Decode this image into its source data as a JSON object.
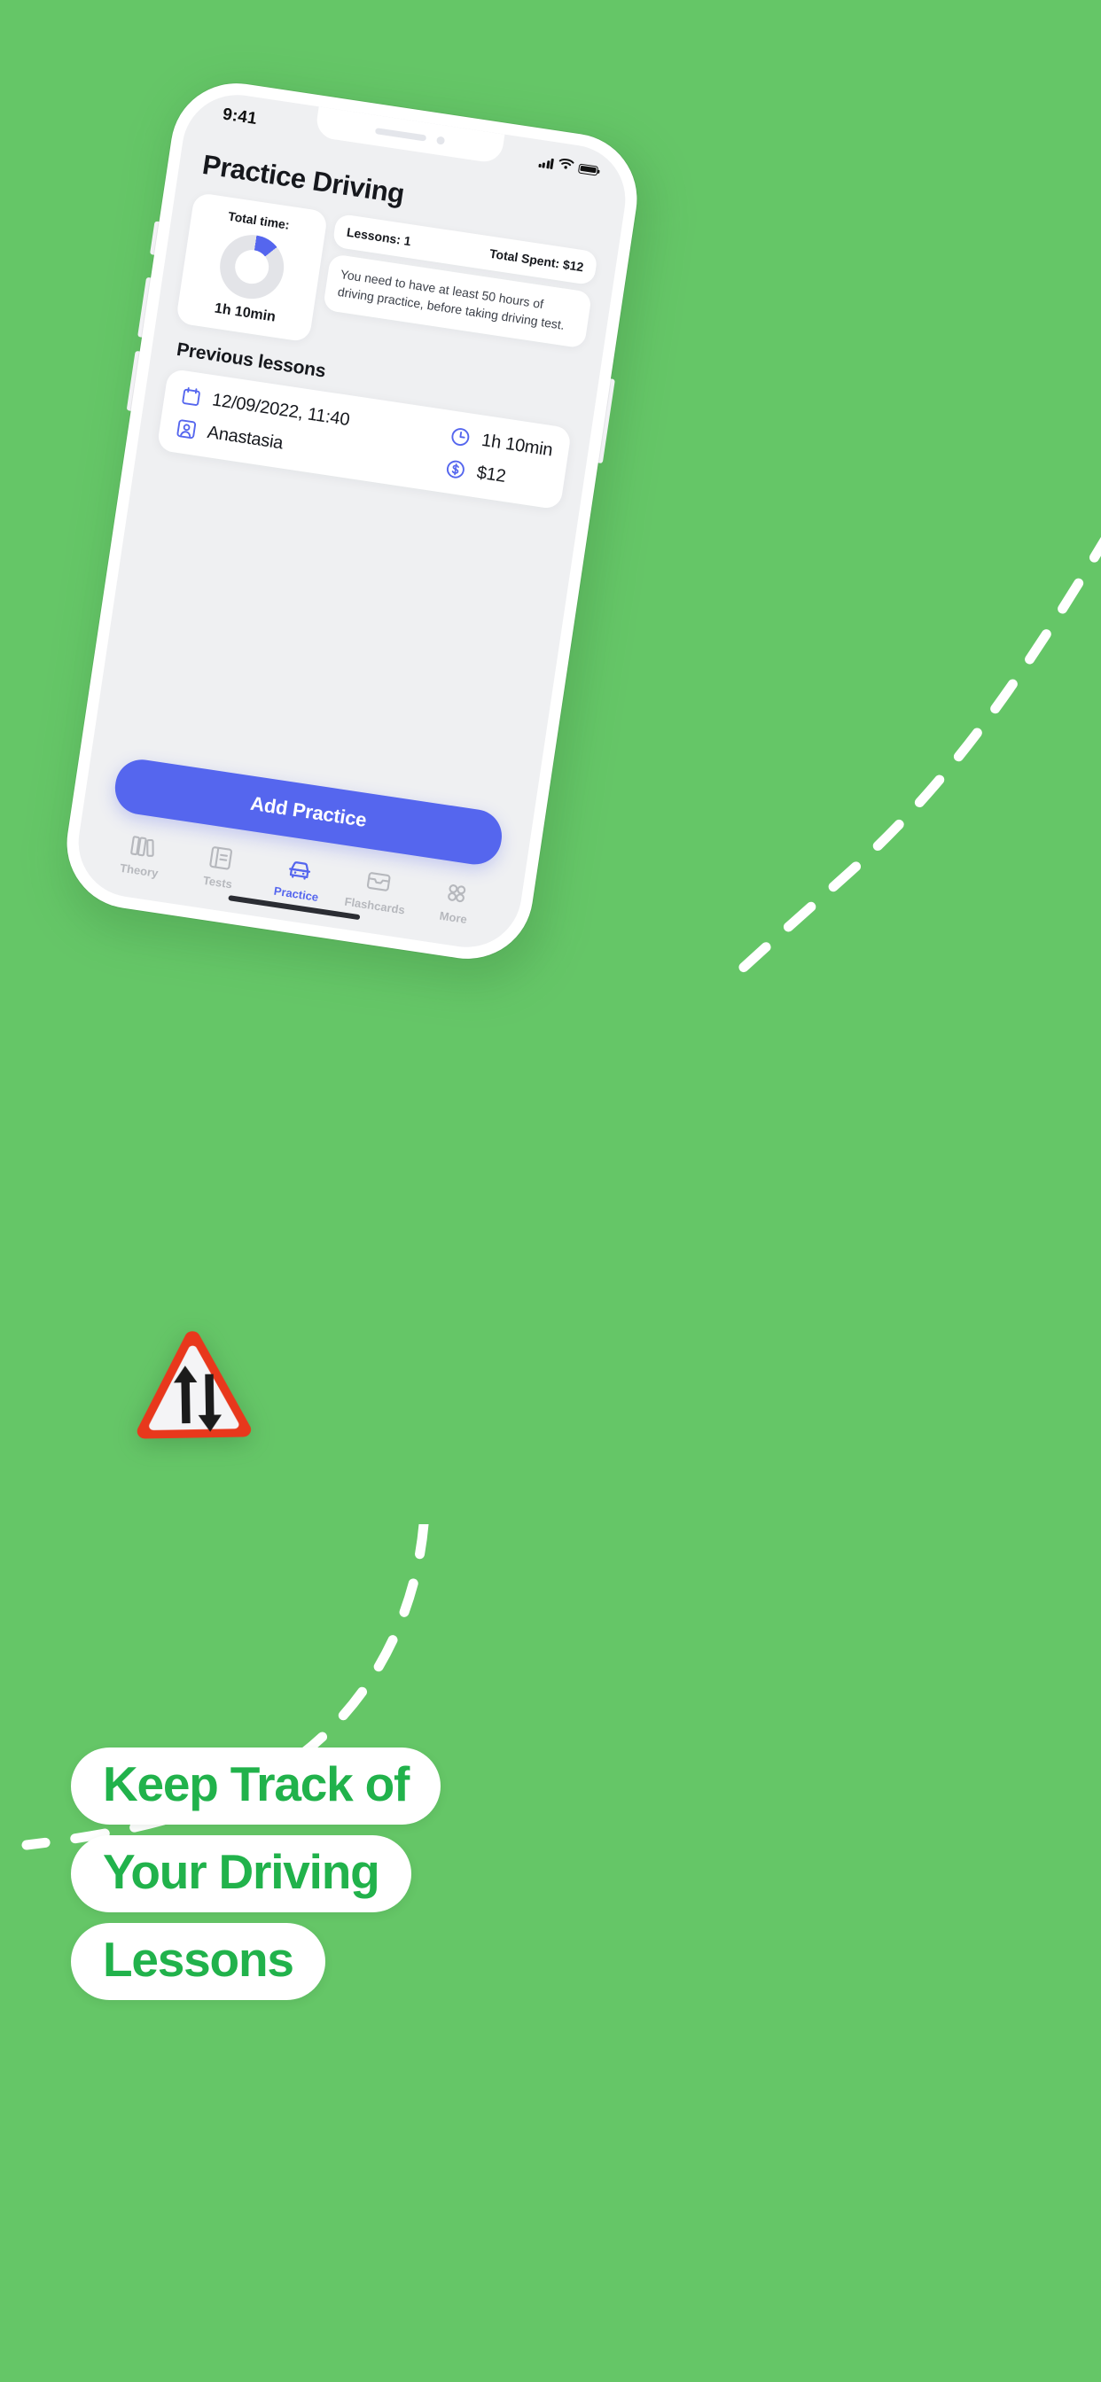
{
  "background_color": "#65c667",
  "accent_color": "#5566ee",
  "headline_color": "#21b24b",
  "phone": {
    "status_bar": {
      "time": "9:41",
      "icons": [
        "cellular-signal-icon",
        "wifi-icon",
        "battery-icon"
      ]
    },
    "app": {
      "page_title": "Practice Driving",
      "total_time_card": {
        "label": "Total time:",
        "value": "1h 10min",
        "progress_percent": 12
      },
      "kpis": {
        "lessons_label": "Lessons: 1",
        "total_spent_label": "Total Spent: $12"
      },
      "note": "You need to have at least 50 hours of driving practice, before taking driving test.",
      "previous_lessons": {
        "section_title": "Previous lessons",
        "items": [
          {
            "date": "12/09/2022, 11:40",
            "instructor": "Anastasia",
            "duration": "1h 10min",
            "price": "$12"
          }
        ]
      },
      "primary_button": "Add Practice",
      "tabs": [
        {
          "label": "Theory",
          "icon": "books-icon",
          "active": false
        },
        {
          "label": "Tests",
          "icon": "notebook-icon",
          "active": false
        },
        {
          "label": "Practice",
          "icon": "car-icon",
          "active": true
        },
        {
          "label": "Flashcards",
          "icon": "card-icon",
          "active": false
        },
        {
          "label": "More",
          "icon": "grid-dots-icon",
          "active": false
        }
      ]
    }
  },
  "road_sign": {
    "name": "two-way-traffic-sign",
    "border_color": "#e8381c",
    "fill_color": "#f4f4f6"
  },
  "headline": {
    "lines": [
      "Keep Track of",
      "Your Driving",
      "Lessons"
    ]
  }
}
